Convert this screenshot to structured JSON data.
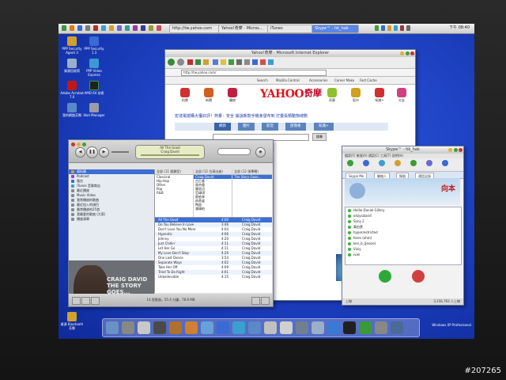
{
  "taskbar": {
    "items": [
      {
        "label": "http://tw.yahoo.com"
      },
      {
        "label": "Yahoo!奇摩 - Micros..."
      },
      {
        "label": "iTunes"
      },
      {
        "label": "Skype™ - hk_hak"
      }
    ],
    "clock": "下午 08:40"
  },
  "desktop_icons": [
    {
      "label": "PPP Security Agent 3"
    },
    {
      "label": "PPP Security 1.3"
    },
    {
      "label": "資源回收筒"
    },
    {
      "label": "PPP Video Express"
    },
    {
      "label": "Adobe Acrobat 7.0"
    },
    {
      "label": "我的網路芳鄰"
    },
    {
      "label": "iKod Manager"
    },
    {
      "label": "AMD 64 技術"
    },
    {
      "label": "資源 Bluetooth 芳鄰"
    }
  ],
  "ie": {
    "title": "Yahoo!奇摩 - Microsoft Internet Explorer",
    "address": "http://tw.yahoo.com/",
    "links": [
      "Search",
      "Mozilla Central",
      "Accessories",
      "Career Make",
      "Fast Cache"
    ],
    "logo": "YAHOO!",
    "logo_cn": "奇摩",
    "headline": "宏達電搶購大獲好評！熱量：安全   據說新款手機會發布到   打靈長類動物總數",
    "nav_icons": [
      "拍賣",
      "新聞",
      "購物",
      "奇摩",
      "股市",
      "知識+",
      "交友"
    ],
    "tabs": [
      "網頁",
      "圖片",
      "影音",
      "部落格",
      "知識+"
    ],
    "search_button": "搜尋",
    "right_links": [
      "Yahoo!奇摩股市",
      "即時新聞 看漲股",
      "今日重要新聞",
      "推薦給您的朋友",
      "全新商品"
    ]
  },
  "itunes": {
    "title": "iTunes",
    "lcd_line1": "All The Good",
    "lcd_line2": "Craig David",
    "sources": [
      {
        "label": "資料庫",
        "selected": true
      },
      {
        "label": "Podcast",
        "selected": false
      },
      {
        "label": "電台",
        "selected": false
      },
      {
        "label": "iTunes 音樂商店",
        "selected": false
      },
      {
        "label": "最近播放",
        "selected": false
      },
      {
        "label": "Music Video",
        "selected": false
      },
      {
        "label": "我常播放的歌曲",
        "selected": false
      },
      {
        "label": "最近加入的項目",
        "selected": false
      },
      {
        "label": "最常播放的25首",
        "selected": false
      },
      {
        "label": "我最愛的歌曲 (大家)",
        "selected": false
      },
      {
        "label": "播放清單",
        "selected": false
      }
    ],
    "genre_header": "全部 (11 個類型)",
    "genres": [
      "Classical",
      "Hip-Hop",
      "Other",
      "Pop",
      "R&B"
    ],
    "artist_header": "全部 (12 位演出者)",
    "artists": [
      "Craig David",
      "古巨基",
      "周杰倫",
      "陳奕迅",
      "范瑋琪",
      "蔡依林",
      "孫燕姿",
      "陶喆",
      "潘瑋柏"
    ],
    "album_header": "全部 (12 張專輯)",
    "albums": [
      "The Story Goes..."
    ],
    "tracks": [
      {
        "name": "All The Good",
        "time": "4:00",
        "artist": "Craig David"
      },
      {
        "name": "Do You Believe In Love",
        "time": "3:46",
        "artist": "Craig David"
      },
      {
        "name": "Don't Love You No More",
        "time": "4:04",
        "artist": "Craig David"
      },
      {
        "name": "Hypnotic",
        "time": "4:06",
        "artist": "Craig David"
      },
      {
        "name": "Johnny",
        "time": "4:20",
        "artist": "Craig David"
      },
      {
        "name": "Just Chillin'",
        "time": "4:11",
        "artist": "Craig David"
      },
      {
        "name": "Let Her Go",
        "time": "4:11",
        "artist": "Craig David"
      },
      {
        "name": "My Love Don't Stop",
        "time": "4:26",
        "artist": "Craig David"
      },
      {
        "name": "One Last Dance",
        "time": "3:54",
        "artist": "Craig David"
      },
      {
        "name": "Separate Ways",
        "time": "4:02",
        "artist": "Craig David"
      },
      {
        "name": "Take Her Off",
        "time": "4:09",
        "artist": "Craig David"
      },
      {
        "name": "Tried To Do Right",
        "time": "4:01",
        "artist": "Craig David"
      },
      {
        "name": "Unbelievable",
        "time": "4:15",
        "artist": "Craig David"
      }
    ],
    "album_art_text": "CRAIG DAVID THE STORY GOES...",
    "status": "14 首歌曲，55.4 分鐘，78.8 MB"
  },
  "skype": {
    "title": "Skype™ - hk_hak",
    "menu": "檔案(F)  帳號(A)  通話(C)  工具(T)  說明(H)",
    "tools": [
      "新增聯絡人",
      "搜尋",
      "會議通話",
      "傳送檔案",
      "個人資料",
      "檔案",
      "說明"
    ],
    "tabs": [
      "Skype Me",
      "聯絡人",
      "撥號",
      "通話記錄"
    ],
    "banner_text": "向本",
    "contacts": [
      "Hollie Daniel Gillery",
      "ohzysaland",
      "Sony 2",
      "黃伯彥",
      "hyperrestricted",
      "fores (ohm)",
      "ken_b_(Jessie)",
      "Viviy",
      "ivan"
    ],
    "status": "上線",
    "online_count": "3,156,763 人上線"
  },
  "windows_version": "Windows XP Professional",
  "watermark": "#207265"
}
